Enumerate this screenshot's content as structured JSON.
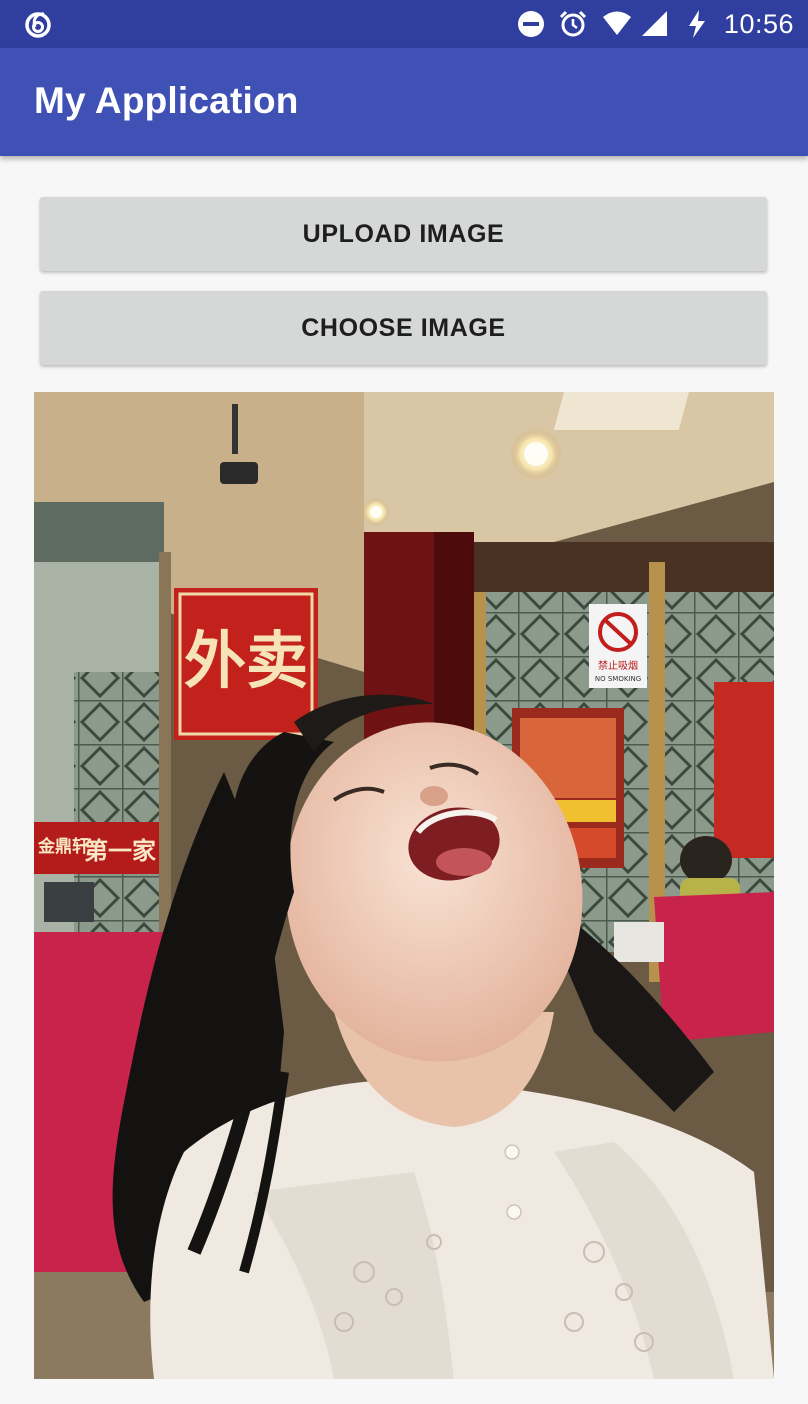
{
  "status_bar": {
    "time": "10:56",
    "left_icon": "notification-swirl-icon",
    "right_icons": [
      "do-not-disturb-icon",
      "alarm-icon",
      "wifi-icon",
      "cell-signal-icon",
      "battery-charging-icon"
    ]
  },
  "app_bar": {
    "title": "My Application",
    "color": "#3f51b5",
    "status_color": "#303f9f"
  },
  "buttons": {
    "upload_label": "UPLOAD IMAGE",
    "choose_label": "CHOOSE IMAGE"
  },
  "image_view": {
    "sign_waimai": "外卖",
    "sign_no_smoking": "禁止吸烟",
    "sign_no_smoking_en": "NO SMOKING",
    "banner_left": "金鼎轩",
    "banner_left_2": "第一家"
  }
}
